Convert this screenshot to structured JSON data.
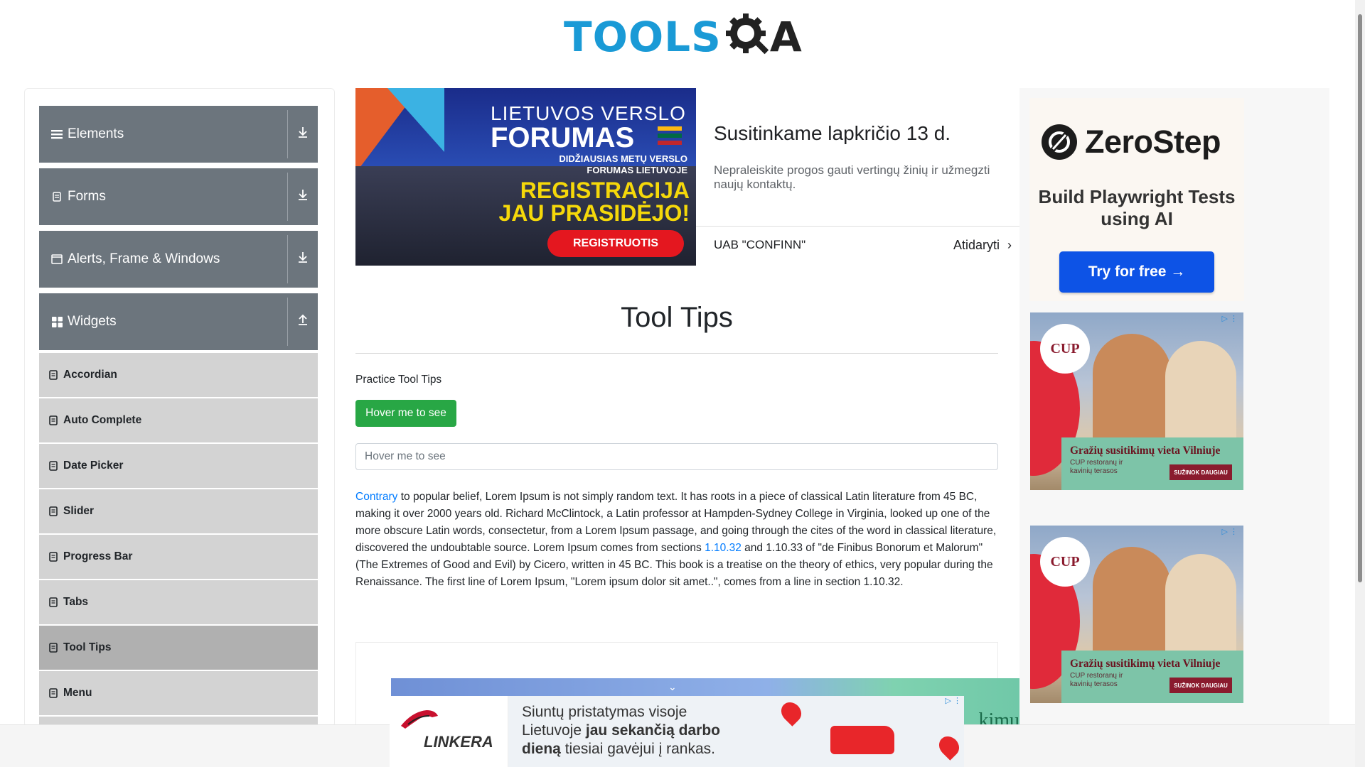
{
  "header": {
    "logo_text": "TOOLS",
    "logo_tail": "A"
  },
  "sidebar": {
    "groups": [
      {
        "label": "Elements",
        "icon": "list-icon",
        "state": "collapsed"
      },
      {
        "label": "Forms",
        "icon": "document-icon",
        "state": "collapsed"
      },
      {
        "label": "Alerts, Frame & Windows",
        "icon": "window-icon",
        "state": "collapsed"
      },
      {
        "label": "Widgets",
        "icon": "grid-icon",
        "state": "expanded"
      }
    ],
    "items": [
      {
        "label": "Accordian"
      },
      {
        "label": "Auto Complete"
      },
      {
        "label": "Date Picker"
      },
      {
        "label": "Slider"
      },
      {
        "label": "Progress Bar"
      },
      {
        "label": "Tabs"
      },
      {
        "label": "Tool Tips",
        "active": true
      },
      {
        "label": "Menu"
      }
    ]
  },
  "banner_ad": {
    "line1": "LIETUVOS VERSLO",
    "line2": "FORUMAS",
    "line3": "DIDŽIAUSIAS METŲ VERSLO FORUMAS LIETUVOJE",
    "line4": "REGISTRACIJA JAU PRASIDĖJO!",
    "cta": "REGISTRUOTIS",
    "title": "Susitinkame lapkričio 13 d.",
    "description": "Nepraleiskite progos gauti vertingų žinių ir užmegzti naujų kontaktų.",
    "advertiser": "UAB \"CONFINN\"",
    "open_label": "Atidaryti"
  },
  "main": {
    "title": "Tool Tips",
    "practice_label": "Practice Tool Tips",
    "button_label": "Hover me to see",
    "input_placeholder": "Hover me to see",
    "paragraph": {
      "link1": "Contrary",
      "text1": " to popular belief, Lorem Ipsum is not simply random text. It has roots in a piece of classical Latin literature from 45 BC, making it over 2000 years old. Richard McClintock, a Latin professor at Hampden-Sydney College in Virginia, looked up one of the more obscure Latin words, consectetur, from a Lorem Ipsum passage, and going through the cites of the word in classical literature, discovered the undoubtable source. Lorem Ipsum comes from sections ",
      "link2": "1.10.32",
      "text2": " and 1.10.33 of \"de Finibus Bonorum et Malorum\" (The Extremes of Good and Evil) by Cicero, written in 45 BC. This book is a treatise on the theory of ethics, very popular during the Renaissance. The first line of Lorem Ipsum, \"Lorem ipsum dolor sit amet..\", comes from a line in section 1.10.32."
    }
  },
  "hidden_ad": {
    "text": "kimu"
  },
  "zerostep_ad": {
    "brand": "ZeroStep",
    "tagline": "Build Playwright Tests using AI",
    "cta": "Try for free →"
  },
  "cup_ad": {
    "logo": "CUP",
    "headline": "Gražių susitikimų vieta Vilniuje",
    "sub": "CUP restoranų ir kavinių terasos",
    "cta": "SUŽINOK DAUGIAU"
  },
  "bottom_ad": {
    "brand": "LINKERA",
    "msg_a": "Siuntų pristatymas visoje Lietuvoje ",
    "msg_b": "jau sekančią darbo dieną",
    "msg_c": " tiesiai gavėjui į rankas."
  },
  "colors": {
    "accent_blue": "#1a9ad6",
    "sidebar_header": "#6c757d",
    "sidebar_item": "#d3d3d3",
    "success_green": "#28a745",
    "link_blue": "#007bff"
  }
}
